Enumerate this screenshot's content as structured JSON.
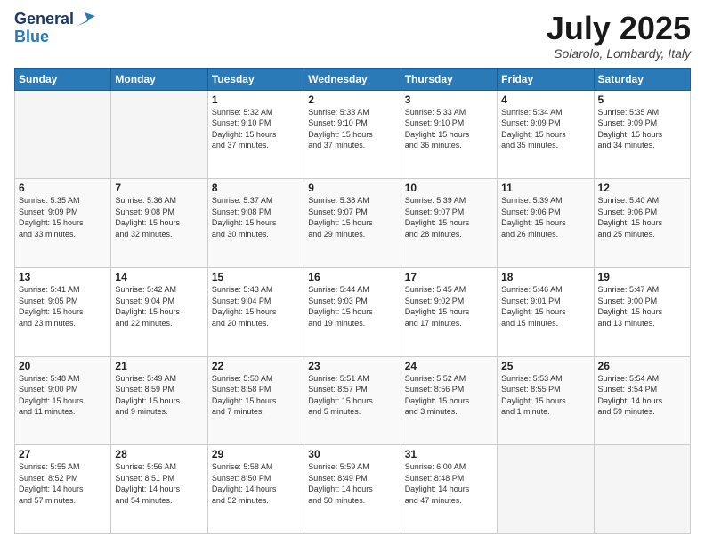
{
  "header": {
    "logo_general": "General",
    "logo_blue": "Blue",
    "month_title": "July 2025",
    "location": "Solarolo, Lombardy, Italy"
  },
  "days_of_week": [
    "Sunday",
    "Monday",
    "Tuesday",
    "Wednesday",
    "Thursday",
    "Friday",
    "Saturday"
  ],
  "weeks": [
    [
      {
        "day": "",
        "info": ""
      },
      {
        "day": "",
        "info": ""
      },
      {
        "day": "1",
        "info": "Sunrise: 5:32 AM\nSunset: 9:10 PM\nDaylight: 15 hours\nand 37 minutes."
      },
      {
        "day": "2",
        "info": "Sunrise: 5:33 AM\nSunset: 9:10 PM\nDaylight: 15 hours\nand 37 minutes."
      },
      {
        "day": "3",
        "info": "Sunrise: 5:33 AM\nSunset: 9:10 PM\nDaylight: 15 hours\nand 36 minutes."
      },
      {
        "day": "4",
        "info": "Sunrise: 5:34 AM\nSunset: 9:09 PM\nDaylight: 15 hours\nand 35 minutes."
      },
      {
        "day": "5",
        "info": "Sunrise: 5:35 AM\nSunset: 9:09 PM\nDaylight: 15 hours\nand 34 minutes."
      }
    ],
    [
      {
        "day": "6",
        "info": "Sunrise: 5:35 AM\nSunset: 9:09 PM\nDaylight: 15 hours\nand 33 minutes."
      },
      {
        "day": "7",
        "info": "Sunrise: 5:36 AM\nSunset: 9:08 PM\nDaylight: 15 hours\nand 32 minutes."
      },
      {
        "day": "8",
        "info": "Sunrise: 5:37 AM\nSunset: 9:08 PM\nDaylight: 15 hours\nand 30 minutes."
      },
      {
        "day": "9",
        "info": "Sunrise: 5:38 AM\nSunset: 9:07 PM\nDaylight: 15 hours\nand 29 minutes."
      },
      {
        "day": "10",
        "info": "Sunrise: 5:39 AM\nSunset: 9:07 PM\nDaylight: 15 hours\nand 28 minutes."
      },
      {
        "day": "11",
        "info": "Sunrise: 5:39 AM\nSunset: 9:06 PM\nDaylight: 15 hours\nand 26 minutes."
      },
      {
        "day": "12",
        "info": "Sunrise: 5:40 AM\nSunset: 9:06 PM\nDaylight: 15 hours\nand 25 minutes."
      }
    ],
    [
      {
        "day": "13",
        "info": "Sunrise: 5:41 AM\nSunset: 9:05 PM\nDaylight: 15 hours\nand 23 minutes."
      },
      {
        "day": "14",
        "info": "Sunrise: 5:42 AM\nSunset: 9:04 PM\nDaylight: 15 hours\nand 22 minutes."
      },
      {
        "day": "15",
        "info": "Sunrise: 5:43 AM\nSunset: 9:04 PM\nDaylight: 15 hours\nand 20 minutes."
      },
      {
        "day": "16",
        "info": "Sunrise: 5:44 AM\nSunset: 9:03 PM\nDaylight: 15 hours\nand 19 minutes."
      },
      {
        "day": "17",
        "info": "Sunrise: 5:45 AM\nSunset: 9:02 PM\nDaylight: 15 hours\nand 17 minutes."
      },
      {
        "day": "18",
        "info": "Sunrise: 5:46 AM\nSunset: 9:01 PM\nDaylight: 15 hours\nand 15 minutes."
      },
      {
        "day": "19",
        "info": "Sunrise: 5:47 AM\nSunset: 9:00 PM\nDaylight: 15 hours\nand 13 minutes."
      }
    ],
    [
      {
        "day": "20",
        "info": "Sunrise: 5:48 AM\nSunset: 9:00 PM\nDaylight: 15 hours\nand 11 minutes."
      },
      {
        "day": "21",
        "info": "Sunrise: 5:49 AM\nSunset: 8:59 PM\nDaylight: 15 hours\nand 9 minutes."
      },
      {
        "day": "22",
        "info": "Sunrise: 5:50 AM\nSunset: 8:58 PM\nDaylight: 15 hours\nand 7 minutes."
      },
      {
        "day": "23",
        "info": "Sunrise: 5:51 AM\nSunset: 8:57 PM\nDaylight: 15 hours\nand 5 minutes."
      },
      {
        "day": "24",
        "info": "Sunrise: 5:52 AM\nSunset: 8:56 PM\nDaylight: 15 hours\nand 3 minutes."
      },
      {
        "day": "25",
        "info": "Sunrise: 5:53 AM\nSunset: 8:55 PM\nDaylight: 15 hours\nand 1 minute."
      },
      {
        "day": "26",
        "info": "Sunrise: 5:54 AM\nSunset: 8:54 PM\nDaylight: 14 hours\nand 59 minutes."
      }
    ],
    [
      {
        "day": "27",
        "info": "Sunrise: 5:55 AM\nSunset: 8:52 PM\nDaylight: 14 hours\nand 57 minutes."
      },
      {
        "day": "28",
        "info": "Sunrise: 5:56 AM\nSunset: 8:51 PM\nDaylight: 14 hours\nand 54 minutes."
      },
      {
        "day": "29",
        "info": "Sunrise: 5:58 AM\nSunset: 8:50 PM\nDaylight: 14 hours\nand 52 minutes."
      },
      {
        "day": "30",
        "info": "Sunrise: 5:59 AM\nSunset: 8:49 PM\nDaylight: 14 hours\nand 50 minutes."
      },
      {
        "day": "31",
        "info": "Sunrise: 6:00 AM\nSunset: 8:48 PM\nDaylight: 14 hours\nand 47 minutes."
      },
      {
        "day": "",
        "info": ""
      },
      {
        "day": "",
        "info": ""
      }
    ]
  ]
}
